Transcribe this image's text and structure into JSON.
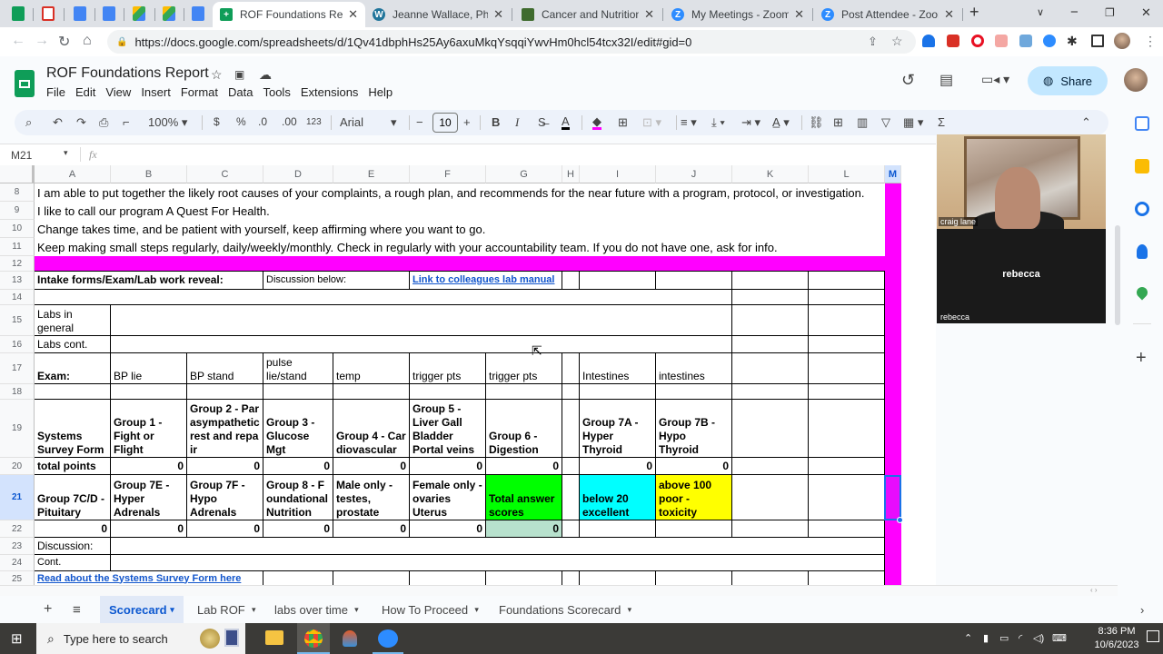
{
  "browser": {
    "pinned_tabs": [
      "sheets-icon",
      "gmail-icon",
      "docs-icon",
      "docs-icon",
      "drive-icon",
      "drive-icon",
      "docs-icon"
    ],
    "tabs": [
      {
        "title": "ROF Foundations Report",
        "icon": "sheets-icon",
        "active": true
      },
      {
        "title": "Jeanne Wallace, PhD —",
        "icon": "wordpress-icon",
        "active": false
      },
      {
        "title": "Cancer and Nutrition, Ca",
        "icon": "site-icon",
        "active": false
      },
      {
        "title": "My Meetings - Zoom",
        "icon": "zoom-icon",
        "active": false
      },
      {
        "title": "Post Attendee - Zoom",
        "icon": "zoom-icon",
        "active": false
      }
    ],
    "url": "https://docs.google.com/spreadsheets/d/1Qv41dbphHs25Ay6axuMkqYsqqiYwvHm0hcl54tcx32I/edit#gid=0",
    "extension_badge": "5"
  },
  "sheets": {
    "doc_title": "ROF Foundations Report",
    "menu": [
      "File",
      "Edit",
      "View",
      "Insert",
      "Format",
      "Data",
      "Tools",
      "Extensions",
      "Help"
    ],
    "share_label": "Share",
    "toolbar": {
      "zoom": "100%",
      "currency": "$",
      "percent": "%",
      "dec_decrease": ".0",
      "dec_increase": ".00",
      "number_format": "123",
      "font": "Arial",
      "font_size": "10",
      "bold": "B",
      "italic": "I",
      "text_color": "A",
      "sum": "Σ"
    },
    "name_box": "M21",
    "fx_label": "fx",
    "columns": [
      "A",
      "B",
      "C",
      "D",
      "E",
      "F",
      "G",
      "H",
      "I",
      "J",
      "K",
      "L",
      "M"
    ],
    "rows": [
      "8",
      "9",
      "10",
      "11",
      "12",
      "13",
      "14",
      "15",
      "16",
      "17",
      "18",
      "19",
      "20",
      "21",
      "22",
      "23",
      "24",
      "25"
    ],
    "intro_lines": [
      "I am able to put together the likely root causes of your complaints, a rough plan, and recommends for the near future with a program, protocol, or investigation.",
      "I like to call our program A Quest For Health.",
      "Change takes time, and be patient with yourself, keep affirming where you want to go.",
      "Keep making small steps regularly, daily/weekly/monthly. Check in regularly with your accountability team.  If you do not have one, ask for info."
    ],
    "r13": {
      "a": "Intake forms/Exam/Lab work reveal:",
      "d": "Discussion below:",
      "f": "Link to colleagues lab manual"
    },
    "r15": {
      "a": "Labs in general"
    },
    "r16": {
      "a": "Labs cont."
    },
    "r17": [
      "Exam:",
      "BP lie",
      "BP stand",
      "pulse lie/stand",
      "temp",
      "trigger pts",
      "trigger pts",
      "",
      "Intestines",
      "intestines"
    ],
    "r19": [
      "Systems Survey Form",
      "Group 1 - Fight or Flight",
      "Group 2 - Parasympathetic rest and repair",
      "Group 3 - Glucose Mgt",
      "Group 4 - Cardiovascular",
      "Group 5 - Liver Gall Bladder Portal veins",
      "Group 6 - Digestion",
      "",
      "Group 7A - Hyper Thyroid",
      "Group 7B - Hypo Thyroid"
    ],
    "r20": [
      "total points",
      "0",
      "0",
      "0",
      "0",
      "0",
      "0",
      "",
      "0",
      "0"
    ],
    "r21": [
      "Group 7C/D - Pituitary",
      "Group 7E - Hyper Adrenals",
      "Group 7F - Hypo Adrenals",
      "Group 8 - Foundational Nutrition",
      "Male only - testes, prostate",
      "Female only - ovaries Uterus",
      "Total answer scores",
      "",
      "below 20 excellent",
      "above 100 poor - toxicity"
    ],
    "r22": [
      "0",
      "0",
      "0",
      "0",
      "0",
      "0",
      "0"
    ],
    "r23": {
      "a": "Discussion:"
    },
    "r24": {
      "a": "Cont."
    },
    "r25": {
      "a": "Read about the Systems Survey Form here"
    },
    "sheet_tabs": [
      "Scorecard",
      "Lab ROF",
      "labs over time",
      "How To Proceed",
      "Foundations Scorecard"
    ],
    "colors": {
      "magenta": "#ff00ff",
      "green": "#00ff00",
      "cyan": "#00ffff",
      "yellow": "#ffff00",
      "light_green": "#b7e1cd"
    }
  },
  "video": {
    "participant_1": "craig lane",
    "participant_2": "rebecca",
    "participant_2_center": "rebecca"
  },
  "taskbar": {
    "search_placeholder": "Type here to search",
    "time": "8:36 PM",
    "date": "10/6/2023"
  }
}
